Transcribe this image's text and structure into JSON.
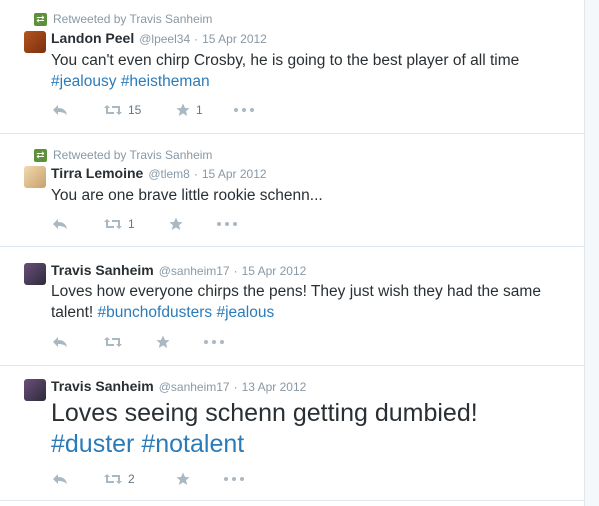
{
  "retweet_label": "Retweeted by Travis Sanheim",
  "tweets": [
    {
      "name": "Landon Peel",
      "handle": "@lpeel34",
      "date": "15 Apr 2012",
      "text_parts": [
        "You can't even chirp Crosby, he is going to the best player of all time"
      ],
      "hashtags": [
        "#jealousy",
        "#heistheman"
      ],
      "retweets": "15",
      "favorites": "1"
    },
    {
      "name": "Tirra Lemoine",
      "handle": "@tlem8",
      "date": "15 Apr 2012",
      "text_parts": [
        "You are one brave little rookie schenn..."
      ],
      "retweets": "1"
    },
    {
      "name": "Travis Sanheim",
      "handle": "@sanheim17",
      "date": "15 Apr 2012",
      "text_parts": [
        "Loves how everyone chirps the pens!  They just wish they had the same",
        "talent!"
      ],
      "hashtags": [
        "#bunchofdusters",
        "#jealous"
      ]
    },
    {
      "name": "Travis Sanheim",
      "handle": "@sanheim17",
      "date": "13 Apr 2012",
      "text_parts": [
        "Loves seeing schenn getting dumbied!"
      ],
      "hashtags": [
        "#duster",
        "#notalent"
      ],
      "retweets": "2"
    }
  ],
  "icons": {
    "retweet_badge": "retweet-icon",
    "reply": "reply-icon",
    "retweet": "retweet-icon",
    "favorite": "star-icon",
    "more": "more-icon"
  },
  "colors": {
    "hashtag": "#2b7bb9",
    "meta": "#8899a6",
    "retweet_badge": "#5c913b"
  }
}
